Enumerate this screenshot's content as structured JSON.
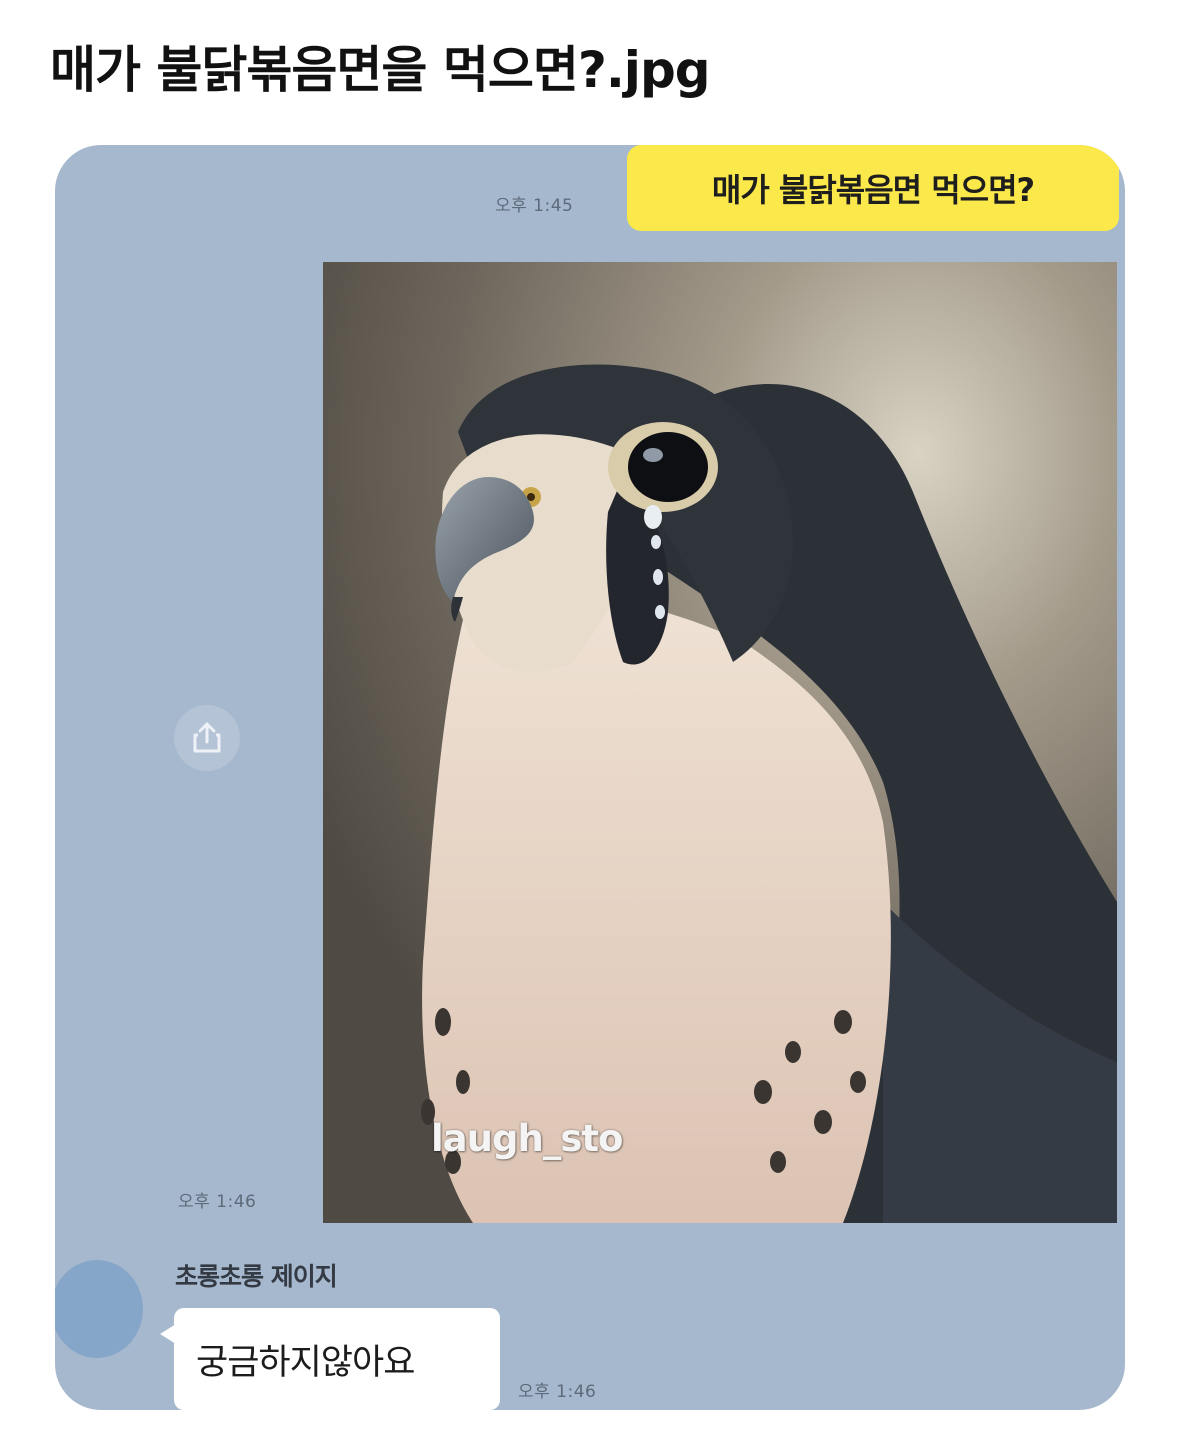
{
  "post": {
    "title": "매가 불닭볶음면을 먹으면?.jpg"
  },
  "chat": {
    "outgoing": {
      "text": "매가 불닭볶음면 먹으면?",
      "time": "오후 1:45"
    },
    "photo": {
      "watermark": "laugh_sto",
      "time": "오후 1:46"
    },
    "incoming": {
      "sender": "초롱초롱 제이지",
      "text": "궁금하지않아요",
      "time": "오후 1:46"
    },
    "icons": {
      "share": "share-icon",
      "avatar": "avatar"
    }
  },
  "colors": {
    "chat_background": "#a6b8cd",
    "outgoing_bubble": "#fbe84a",
    "incoming_bubble": "#ffffff",
    "avatar": "#86a6c9"
  }
}
